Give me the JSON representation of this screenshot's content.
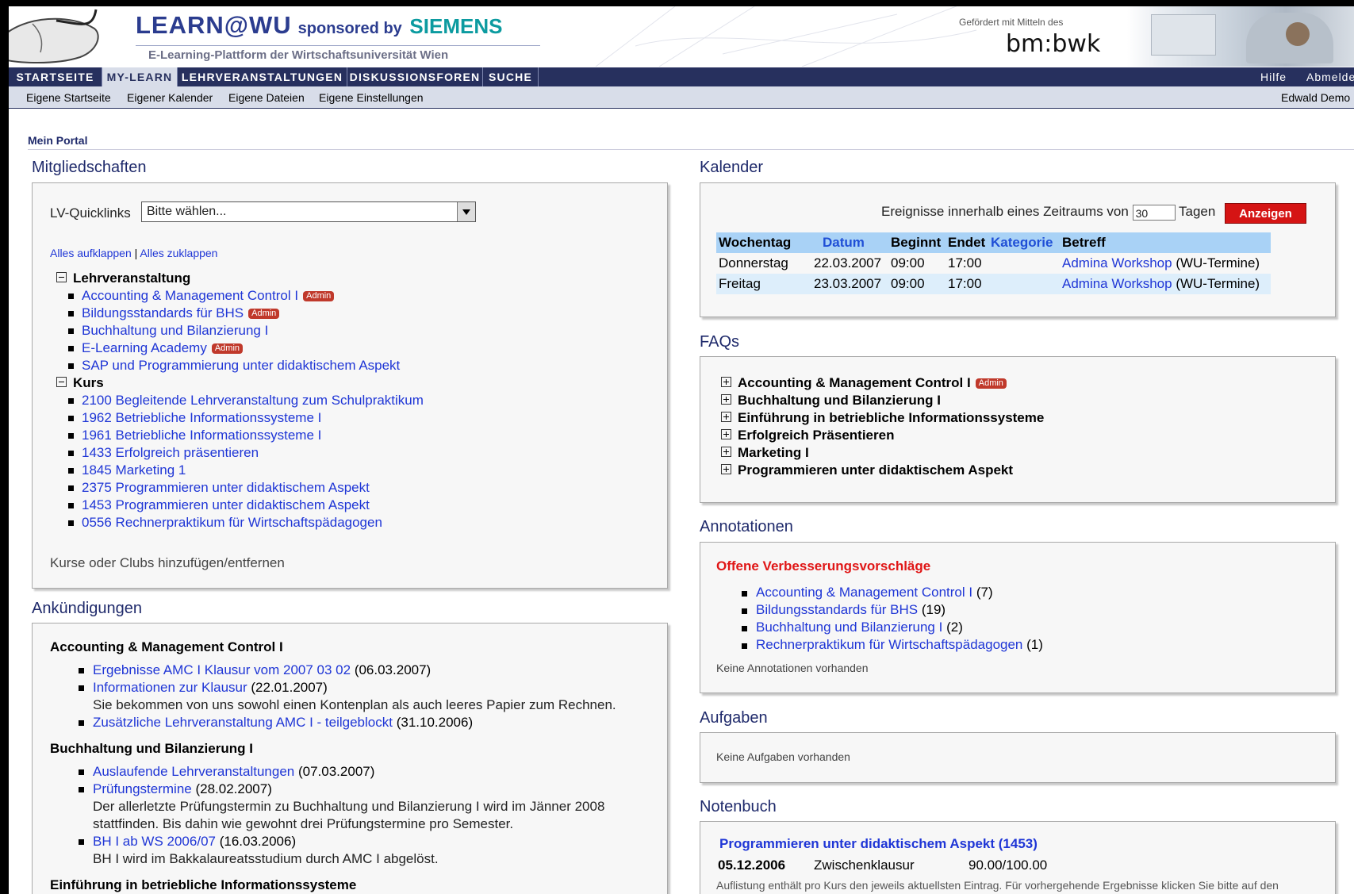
{
  "header": {
    "brand": "LEARN@WU",
    "sponsor": "sponsored by",
    "sponsor_name": "SIEMENS",
    "subtitle": "E-Learning-Plattform der Wirtschaftsuniversität Wien",
    "funding_note": "Gefördert mit Mitteln des",
    "funding_org": "bm:bwk"
  },
  "nav": {
    "tabs": [
      "STARTSEITE",
      "MY-LEARN",
      "LEHRVERANSTALTUNGEN",
      "DISKUSSIONSFOREN",
      "SUCHE"
    ],
    "active_tab": "MY-LEARN",
    "right": [
      "Hilfe",
      "Abmelden"
    ]
  },
  "subnav": {
    "items": [
      "Eigene Startseite",
      "Eigener Kalender",
      "Eigene Dateien",
      "Eigene Einstellungen"
    ],
    "user": "Edwald Demo"
  },
  "portal_title": "Mein Portal",
  "mitgliedschaften": {
    "heading": "Mitgliedschaften",
    "quicklinks_label": "LV-Quicklinks",
    "quicklinks_value": "Bitte wählen...",
    "expand_all": "Alles aufklappen",
    "separator": "|",
    "collapse_all": "Alles zuklappen",
    "admin_badge": "Admin",
    "groups": [
      {
        "label": "Lehrveranstaltung",
        "items": [
          {
            "label": "Accounting & Management Control I",
            "admin": true
          },
          {
            "label": "Bildungsstandards für BHS",
            "admin": true
          },
          {
            "label": "Buchhaltung und Bilanzierung I",
            "admin": false
          },
          {
            "label": "E-Learning Academy",
            "admin": true
          },
          {
            "label": "SAP und Programmierung unter didaktischem Aspekt",
            "admin": false
          }
        ]
      },
      {
        "label": "Kurs",
        "items": [
          {
            "label": "2100 Begleitende Lehrveranstaltung zum Schulpraktikum",
            "admin": false
          },
          {
            "label": "1962 Betriebliche Informationssysteme I",
            "admin": false
          },
          {
            "label": "1961 Betriebliche Informationssysteme I",
            "admin": false
          },
          {
            "label": "1433 Erfolgreich präsentieren",
            "admin": false
          },
          {
            "label": "1845 Marketing 1",
            "admin": false
          },
          {
            "label": "2375 Programmieren unter didaktischem Aspekt",
            "admin": false
          },
          {
            "label": "1453 Programmieren unter didaktischem Aspekt",
            "admin": false
          },
          {
            "label": "0556 Rechnerpraktikum für Wirtschaftspädagogen",
            "admin": false
          }
        ]
      }
    ],
    "add_link": "Kurse oder Clubs hinzufügen/entfernen"
  },
  "ankuendigungen": {
    "heading": "Ankündigungen",
    "groups": [
      {
        "title": "Accounting & Management Control I",
        "items": [
          {
            "link": "Ergebnisse AMC I Klausur vom 2007 03 02",
            "date": "(06.03.2007)",
            "desc": ""
          },
          {
            "link": "Informationen zur Klausur",
            "date": "(22.01.2007)",
            "desc": "Sie bekommen von uns sowohl einen Kontenplan als auch leeres Papier zum Rechnen."
          },
          {
            "link": "Zusätzliche Lehrveranstaltung AMC I - teilgeblockt",
            "date": "(31.10.2006)",
            "desc": ""
          }
        ]
      },
      {
        "title": "Buchhaltung und Bilanzierung I",
        "items": [
          {
            "link": "Auslaufende Lehrveranstaltungen",
            "date": "(07.03.2007)",
            "desc": ""
          },
          {
            "link": "Prüfungstermine",
            "date": "(28.02.2007)",
            "desc": "Der allerletzte Prüfungstermin zu Buchhaltung und Bilanzierung I wird im Jänner 2008 stattfinden. Bis dahin wie gewohnt drei Prüfungstermine pro Semester."
          },
          {
            "link": "BH I ab WS 2006/07",
            "date": "(16.03.2006)",
            "desc": "BH I wird im Bakkalaureatsstudium durch AMC I abgelöst."
          }
        ]
      },
      {
        "title": "Einführung in betriebliche Informationssysteme",
        "items": []
      }
    ]
  },
  "kalender": {
    "heading": "Kalender",
    "range_prefix": "Ereignisse innerhalb eines Zeitraums von",
    "range_value": "30",
    "range_suffix": "Tagen",
    "show_button": "Anzeigen",
    "columns": [
      "Wochentag",
      "Datum",
      "Beginnt",
      "Endet",
      "Kategorie",
      "Betreff"
    ],
    "rows": [
      {
        "day": "Donnerstag",
        "date": "22.03.2007",
        "start": "09:00",
        "end": "17:00",
        "category": "",
        "subject": "Admina Workshop",
        "subject_note": "(WU-Termine)"
      },
      {
        "day": "Freitag",
        "date": "23.03.2007",
        "start": "09:00",
        "end": "17:00",
        "category": "",
        "subject": "Admina Workshop",
        "subject_note": "(WU-Termine)"
      }
    ]
  },
  "faqs": {
    "heading": "FAQs",
    "items": [
      {
        "label": "Accounting & Management Control I",
        "admin": true
      },
      {
        "label": "Buchhaltung und Bilanzierung I",
        "admin": false
      },
      {
        "label": "Einführung in betriebliche Informationssysteme",
        "admin": false
      },
      {
        "label": "Erfolgreich Präsentieren",
        "admin": false
      },
      {
        "label": "Marketing I",
        "admin": false
      },
      {
        "label": "Programmieren unter didaktischem Aspekt",
        "admin": false
      }
    ]
  },
  "annotationen": {
    "heading": "Annotationen",
    "open_title": "Offene Verbesserungsvorschläge",
    "items": [
      {
        "label": "Accounting & Management Control I",
        "count": "(7)"
      },
      {
        "label": "Bildungsstandards für BHS",
        "count": "(19)"
      },
      {
        "label": "Buchhaltung und Bilanzierung I",
        "count": "(2)"
      },
      {
        "label": "Rechnerpraktikum für Wirtschaftspädagogen",
        "count": "(1)"
      }
    ],
    "none_text": "Keine Annotationen vorhanden"
  },
  "aufgaben": {
    "heading": "Aufgaben",
    "none_text": "Keine Aufgaben vorhanden"
  },
  "notenbuch": {
    "heading": "Notenbuch",
    "course": "Programmieren unter didaktischem Aspekt (1453)",
    "entry_date": "05.12.2006",
    "entry_title": "Zwischenklausur",
    "entry_score": "90.00/100.00",
    "note": "Auflistung enthält pro Kurs den jeweils aktuellsten Eintrag. Für vorhergehende Ergebnisse klicken Sie bitte auf den"
  }
}
